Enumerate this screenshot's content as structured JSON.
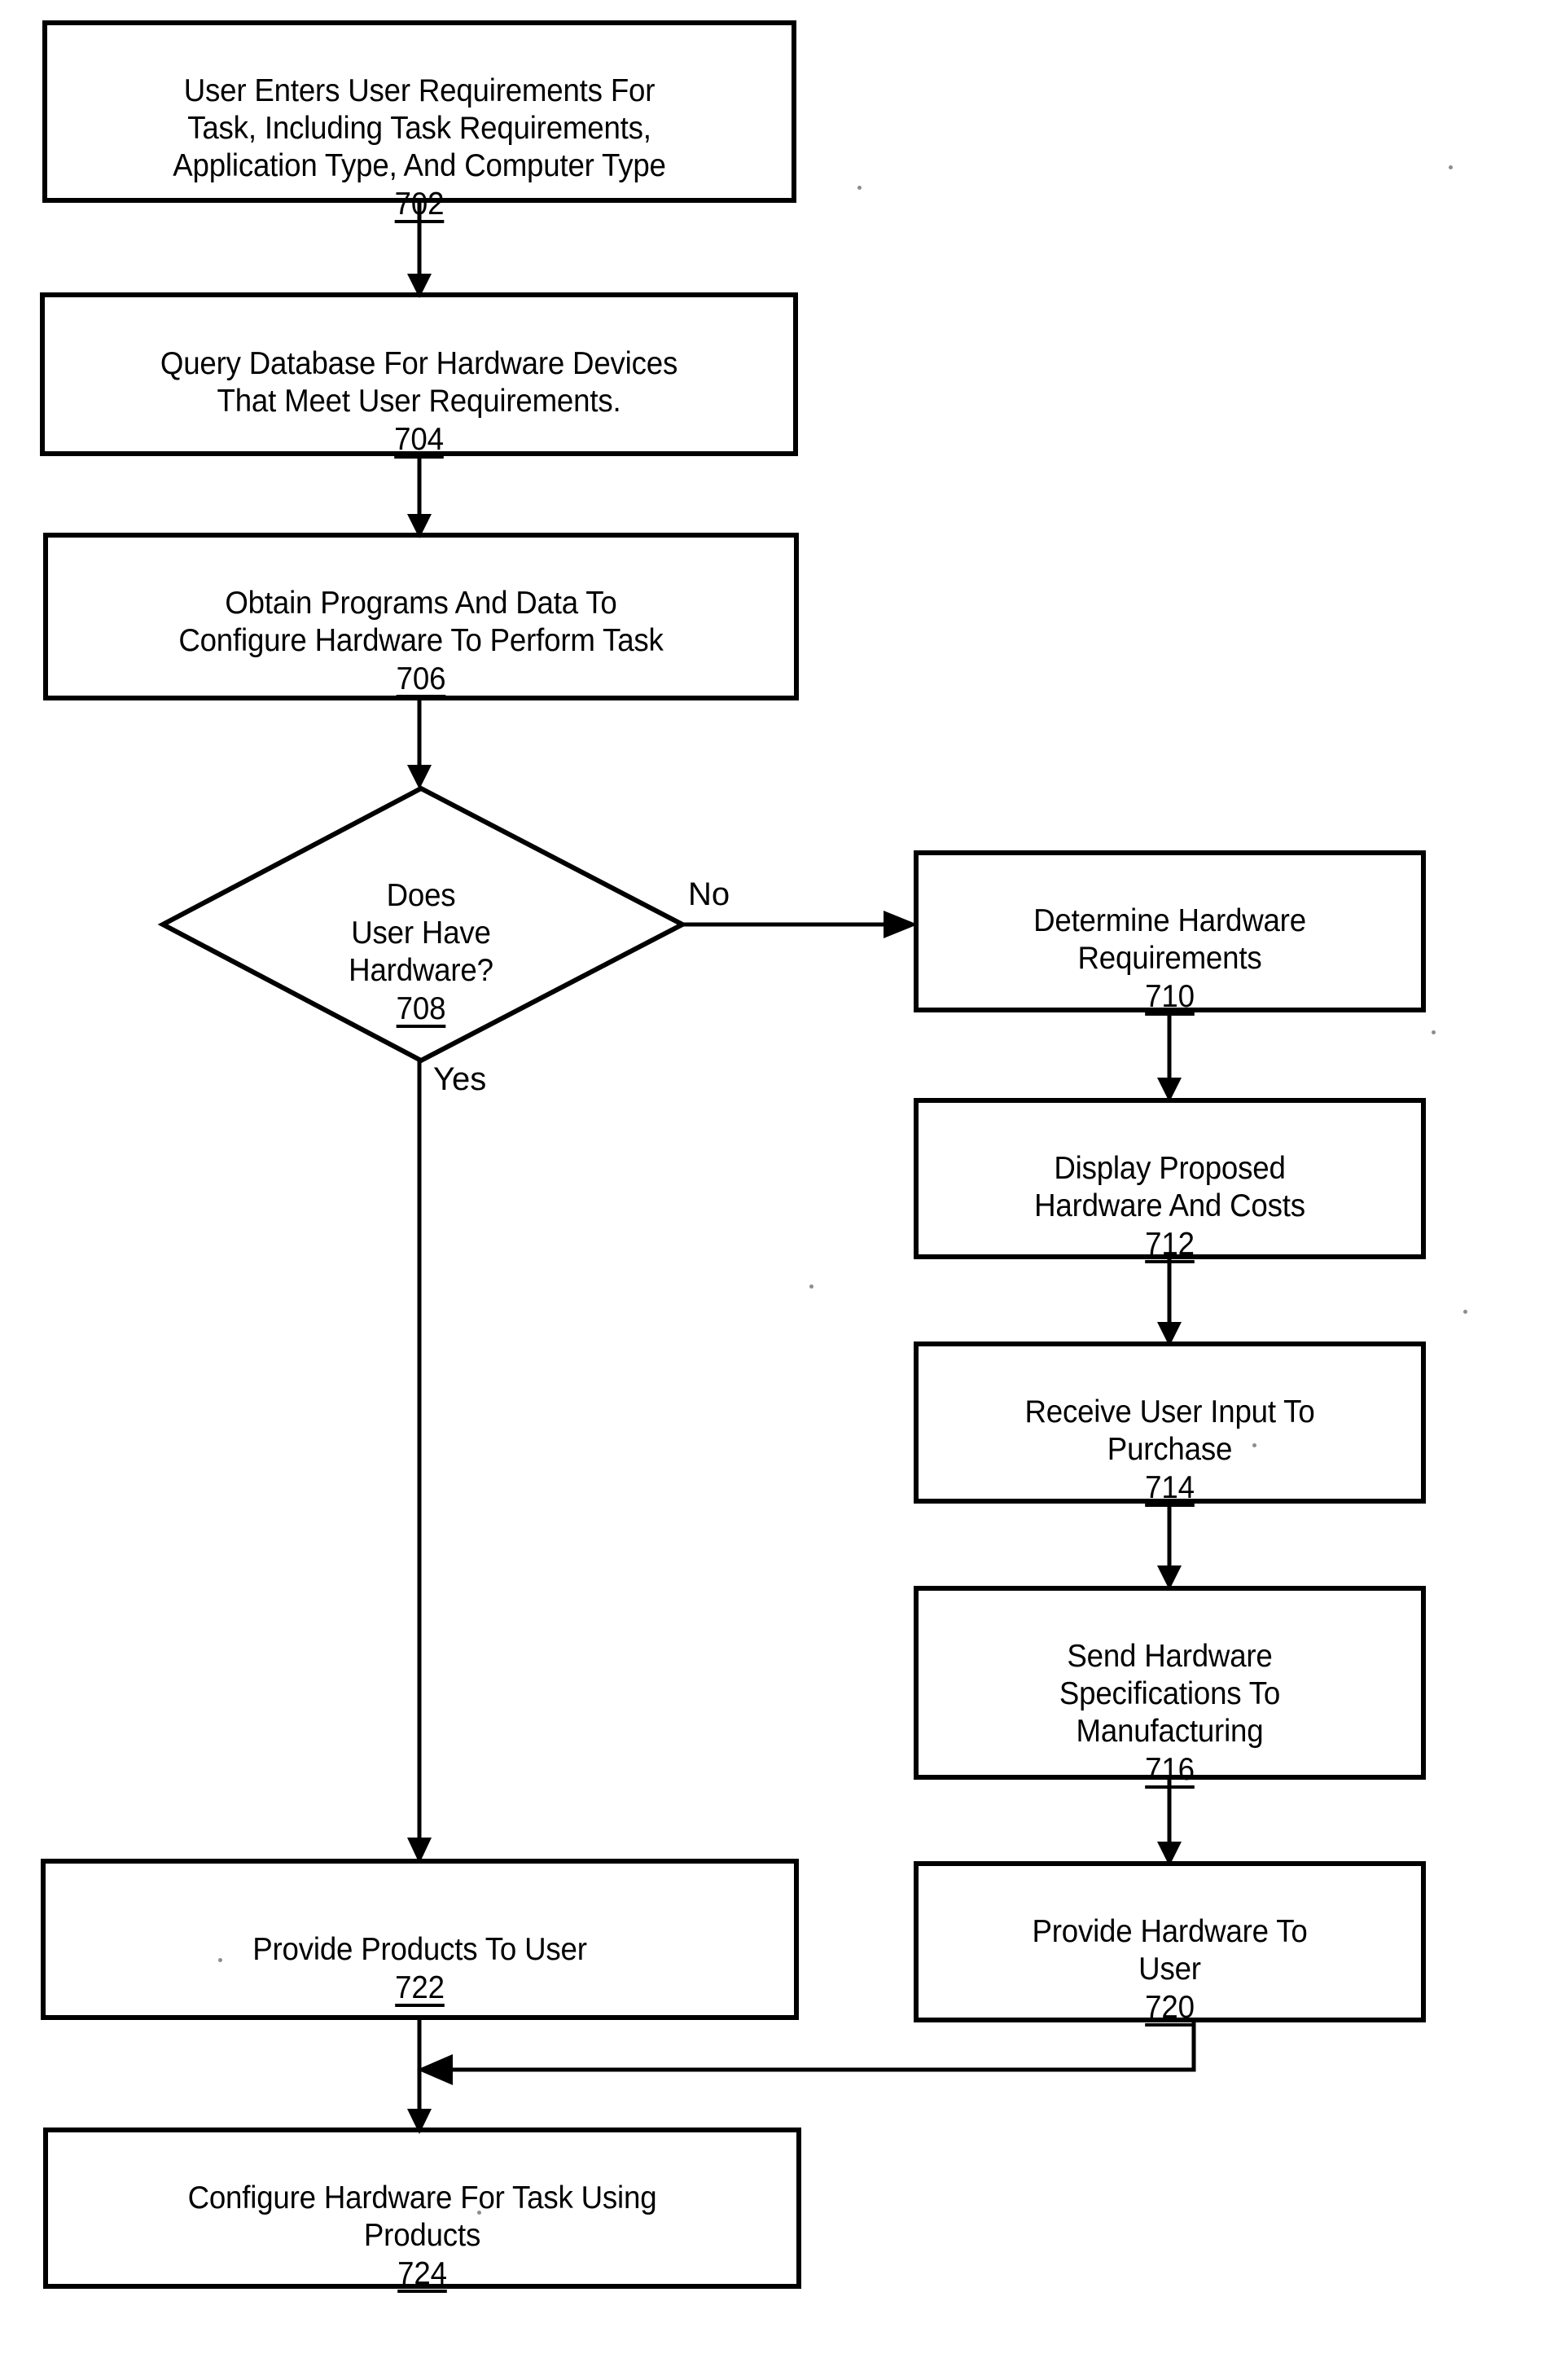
{
  "figure": {
    "type": "flowchart",
    "orientation": "top-to-bottom",
    "background_color": "#ffffff",
    "line_color": "#000000"
  },
  "nodes": [
    {
      "id": "n702",
      "shape": "process",
      "text": "User Enters User Requirements For\nTask, Including Task Requirements,\nApplication Type, And Computer Type",
      "ref": "702"
    },
    {
      "id": "n704",
      "shape": "process",
      "text": "Query Database For Hardware Devices\nThat Meet User Requirements.",
      "ref": "704"
    },
    {
      "id": "n706",
      "shape": "process",
      "text": "Obtain Programs And Data To\nConfigure Hardware To Perform Task",
      "ref": "706"
    },
    {
      "id": "n708",
      "shape": "decision",
      "text": "Does\nUser Have\nHardware?",
      "ref": "708"
    },
    {
      "id": "n710",
      "shape": "process",
      "text": "Determine Hardware\nRequirements",
      "ref": "710"
    },
    {
      "id": "n712",
      "shape": "process",
      "text": "Display Proposed\nHardware And Costs",
      "ref": "712"
    },
    {
      "id": "n714",
      "shape": "process",
      "text": "Receive User Input To\nPurchase",
      "ref": "714"
    },
    {
      "id": "n716",
      "shape": "process",
      "text": "Send Hardware\nSpecifications To\nManufacturing",
      "ref": "716"
    },
    {
      "id": "n720",
      "shape": "process",
      "text": "Provide Hardware To\nUser",
      "ref": "720"
    },
    {
      "id": "n722",
      "shape": "process",
      "text": "Provide Products To User",
      "ref": "722"
    },
    {
      "id": "n724",
      "shape": "process",
      "text": "Configure Hardware For Task Using\nProducts",
      "ref": "724"
    }
  ],
  "edges": [
    {
      "id": "e702-704",
      "from": "n702",
      "to": "n704",
      "label": ""
    },
    {
      "id": "e704-706",
      "from": "n704",
      "to": "n706",
      "label": ""
    },
    {
      "id": "e706-708",
      "from": "n706",
      "to": "n708",
      "label": ""
    },
    {
      "id": "e708-710",
      "from": "n708",
      "to": "n710",
      "label": "No"
    },
    {
      "id": "e708-722",
      "from": "n708",
      "to": "n722",
      "label": "Yes"
    },
    {
      "id": "e710-712",
      "from": "n710",
      "to": "n712",
      "label": ""
    },
    {
      "id": "e712-714",
      "from": "n712",
      "to": "n714",
      "label": ""
    },
    {
      "id": "e714-716",
      "from": "n714",
      "to": "n716",
      "label": ""
    },
    {
      "id": "e716-720",
      "from": "n716",
      "to": "n720",
      "label": ""
    },
    {
      "id": "e720-merge",
      "from": "n720",
      "to": "n724",
      "label": ""
    },
    {
      "id": "e722-724",
      "from": "n722",
      "to": "n724",
      "label": ""
    }
  ],
  "edge_labels": {
    "no": "No",
    "yes": "Yes"
  }
}
